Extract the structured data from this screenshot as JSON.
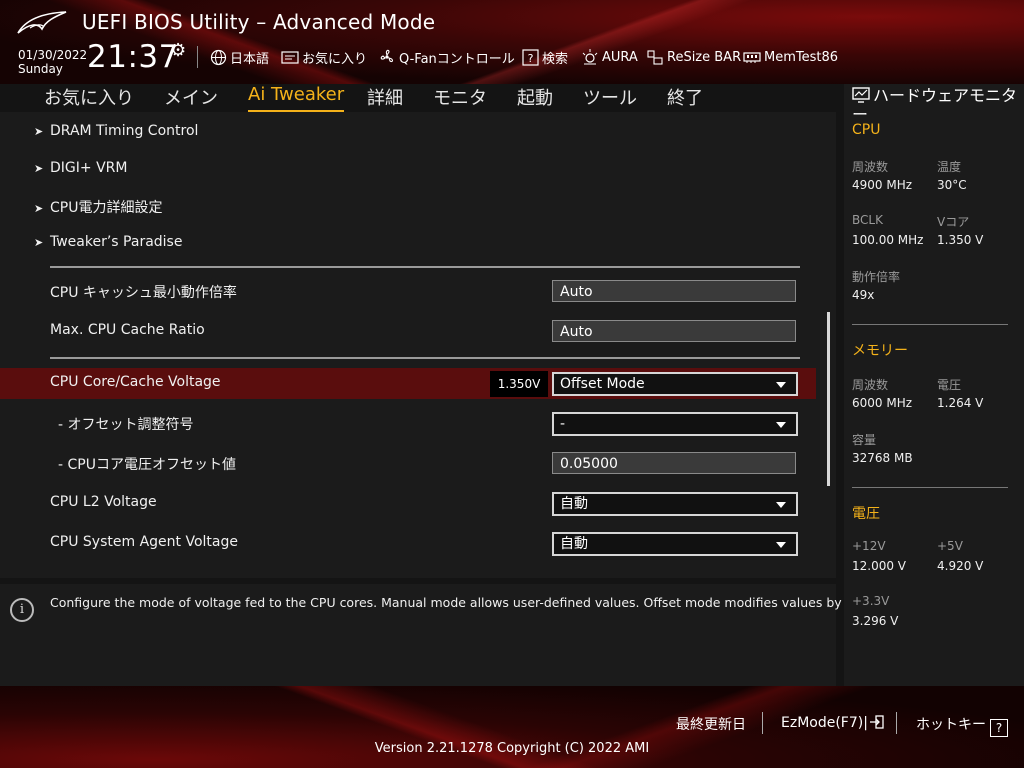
{
  "header": {
    "title": "UEFI BIOS Utility – Advanced Mode",
    "date": "01/30/2022",
    "day": "Sunday",
    "time": "21:37",
    "toolbar": [
      {
        "label": "日本語",
        "icon": "globe-icon"
      },
      {
        "label": "お気に入り",
        "icon": "favorites-icon"
      },
      {
        "label": "Q-Fanコントロール",
        "icon": "fan-icon"
      },
      {
        "label": "検索",
        "icon": "search-icon"
      },
      {
        "label": "AURA",
        "icon": "aura-icon"
      },
      {
        "label": "ReSize BAR",
        "icon": "resize-bar-icon"
      },
      {
        "label": "MemTest86",
        "icon": "memtest-icon"
      }
    ]
  },
  "nav": {
    "tabs": [
      "お気に入り",
      "メイン",
      "Ai Tweaker",
      "詳細",
      "モニタ",
      "起動",
      "ツール",
      "終了"
    ],
    "active": "Ai Tweaker"
  },
  "main": {
    "submenus": [
      "DRAM Timing Control",
      "DIGI+ VRM",
      "CPU電力詳細設定",
      "Tweaker’s Paradise"
    ],
    "settings": [
      {
        "label": "CPU キャッシュ最小動作倍率",
        "value": "Auto"
      },
      {
        "label": "Max. CPU Cache Ratio",
        "value": "Auto"
      },
      {
        "label": "CPU Core/Cache Voltage",
        "value": "Offset Mode",
        "badge": "1.350V"
      },
      {
        "label": "- オフセット調整符号",
        "value": "-"
      },
      {
        "label": "- CPUコア電圧オフセット値",
        "value": "0.05000"
      },
      {
        "label": "CPU L2 Voltage",
        "value": "自動"
      },
      {
        "label": "CPU System Agent Voltage",
        "value": "自動"
      }
    ]
  },
  "help": {
    "text": "Configure the mode of voltage fed to the CPU cores. Manual mode allows user-defined values. Offset mode modifies values by SVID."
  },
  "hw_monitor": {
    "title": "ハードウェアモニター",
    "cpu": {
      "section": "CPU",
      "freq_label": "周波数",
      "freq": "4900 MHz",
      "temp_label": "温度",
      "temp": "30°C",
      "bclk_label": "BCLK",
      "bclk": "100.00 MHz",
      "vcore_label": "Vコア",
      "vcore": "1.350 V",
      "ratio_label": "動作倍率",
      "ratio": "49x"
    },
    "memory": {
      "section": "メモリー",
      "freq_label": "周波数",
      "freq": "6000 MHz",
      "volt_label": "電圧",
      "volt": "1.264 V",
      "cap_label": "容量",
      "cap": "32768 MB"
    },
    "voltage": {
      "section": "電圧",
      "v12_label": "+12V",
      "v12": "12.000 V",
      "v5_label": "+5V",
      "v5": "4.920 V",
      "v33_label": "+3.3V",
      "v33": "3.296 V"
    }
  },
  "footer": {
    "last_modified": "最終更新日",
    "ezmode": "EzMode(F7)|",
    "hotkeys": "ホットキー",
    "hotkey_symbol": "?",
    "version": "Version 2.21.1278 Copyright (C) 2022 AMI"
  },
  "colors": {
    "accent": "#f4b21a",
    "selected_row": "#5a0d0d"
  }
}
